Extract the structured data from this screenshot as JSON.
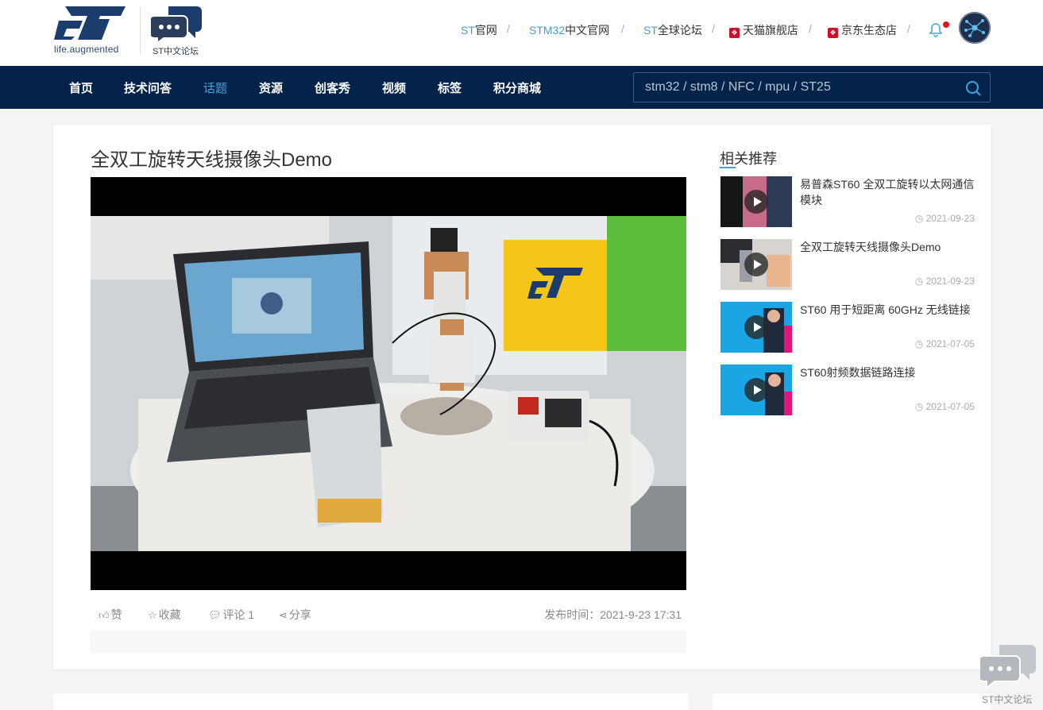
{
  "header": {
    "logo_tagline": "life.augmented",
    "forum_logo_label": "ST中文论坛",
    "links": [
      {
        "accent": "ST",
        "rest": "官网"
      },
      {
        "accent": "STM32",
        "rest": "中文官网"
      },
      {
        "accent": "ST",
        "rest": "全球论坛"
      },
      {
        "accent": "",
        "rest": "天猫旗舰店"
      },
      {
        "accent": "",
        "rest": "京东生态店"
      }
    ],
    "separator": "/"
  },
  "nav": {
    "items": [
      "首页",
      "技术问答",
      "话题",
      "资源",
      "创客秀",
      "视频",
      "标签",
      "积分商城"
    ],
    "active_index": 2,
    "search_placeholder": "stm32 / stm8 / NFC / mpu / ST25"
  },
  "post": {
    "title": "全双工旋转天线摄像头Demo",
    "actions": {
      "like": "赞",
      "favorite": "收藏",
      "comment": "评论 1",
      "share": "分享"
    },
    "publish_time": "发布时间：2021-9-23 17:31"
  },
  "sidebar": {
    "title": "相关推荐",
    "items": [
      {
        "title": "易普森ST60 全双工旋转以太网通信模块",
        "date": "2021-09-23"
      },
      {
        "title": "全双工旋转天线摄像头Demo",
        "date": "2021-09-23"
      },
      {
        "title": "ST60 用于短距离 60GHz 无线链接",
        "date": "2021-07-05"
      },
      {
        "title": "ST60射频数据链路连接",
        "date": "2021-07-05"
      }
    ]
  },
  "floating": {
    "label": "ST中文论坛"
  },
  "colors": {
    "nav_bg": "#03234b",
    "accent": "#3fa6e0",
    "link_accent": "#3fa0d8",
    "brand_dark": "#1b3d6e"
  }
}
